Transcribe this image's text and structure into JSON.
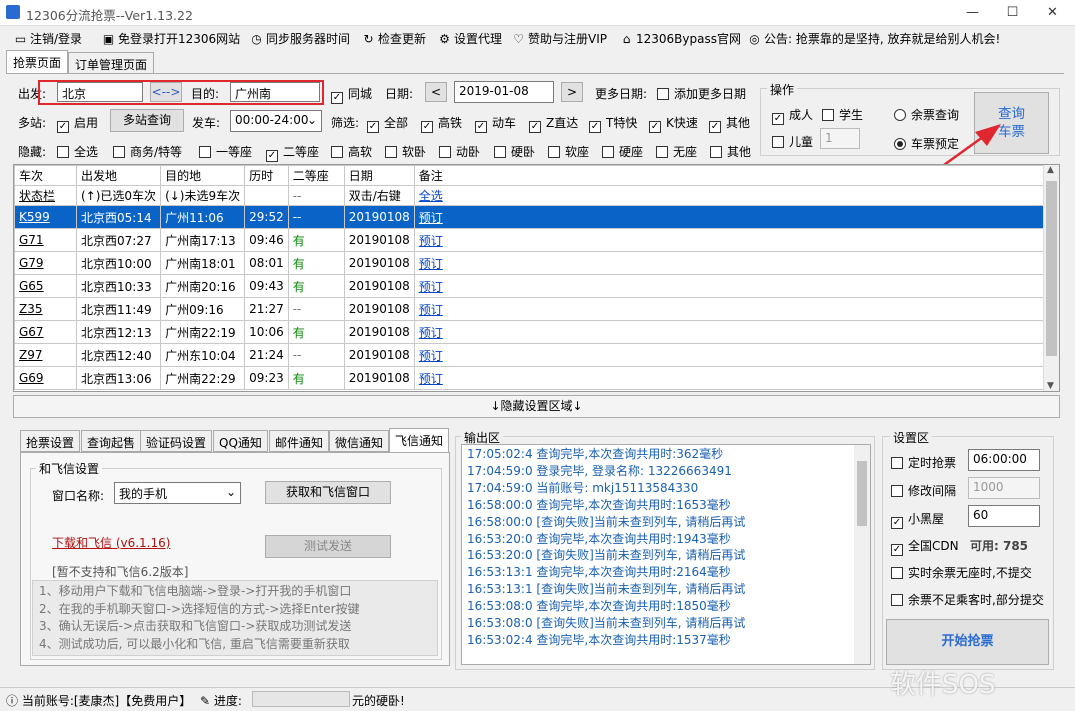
{
  "window": {
    "title": "12306分流抢票--Ver1.13.22",
    "min": "—",
    "max": "☐",
    "close": "✕"
  },
  "menu": [
    {
      "icon": "▭",
      "label": "注销/登录"
    },
    {
      "icon": "▣",
      "label": "免登录打开12306网站"
    },
    {
      "icon": "◷",
      "label": "同步服务器时间"
    },
    {
      "icon": "↻",
      "label": "检查更新"
    },
    {
      "icon": "⚙",
      "label": "设置代理"
    },
    {
      "icon": "♡",
      "label": "赞助与注册VIP"
    },
    {
      "icon": "⌂",
      "label": "12306Bypass官网"
    },
    {
      "icon": "◎",
      "label": "公告: 抢票靠的是坚持, 放弃就是给别人机会!"
    }
  ],
  "tabs": [
    "抢票页面",
    "订单管理页面"
  ],
  "query": {
    "from_label": "出发:",
    "from": "北京",
    "swap": "<-->",
    "to_label": "目的:",
    "to": "广州南",
    "tongcheng": "同城",
    "date_label": "日期:",
    "date": "2019-01-08",
    "prev": "<",
    "next": ">",
    "more_dates_label": "更多日期:",
    "add_more_dates": "添加更多日期",
    "multi_label": "多站:",
    "multi_enable": "启用",
    "multi_query": "多站查询",
    "depart_label": "发车:",
    "depart_time": "00:00-24:00",
    "filter_label": "筛选:",
    "filters": [
      "全部",
      "高铁",
      "动车",
      "Z直达",
      "T特快",
      "K快速",
      "其他"
    ],
    "hide_label": "隐藏:",
    "hides": [
      "全选",
      "商务/特等",
      "一等座",
      "二等座",
      "高软",
      "软卧",
      "动卧",
      "硬卧",
      "软座",
      "硬座",
      "无座",
      "其他"
    ]
  },
  "ops": {
    "title": "操作",
    "adult": "成人",
    "student": "学生",
    "child": "儿童",
    "child_count": "1",
    "remain": "余票查询",
    "book": "车票预定",
    "query_btn1": "查询",
    "query_btn2": "车票"
  },
  "table": {
    "headers": [
      "车次",
      "出发地",
      "目的地",
      "历时",
      "二等座",
      "日期",
      "备注"
    ],
    "sub": [
      "状态栏",
      "(↑)已选0车次",
      "(↓)未选9车次",
      "",
      "--",
      "双击/右键",
      "全选"
    ],
    "rows": [
      [
        "K599",
        "北京西05:14",
        "广州11:06",
        "29:52",
        "--",
        "20190108",
        "预订"
      ],
      [
        "G71",
        "北京西07:27",
        "广州南17:13",
        "09:46",
        "有",
        "20190108",
        "预订"
      ],
      [
        "G79",
        "北京西10:00",
        "广州南18:01",
        "08:01",
        "有",
        "20190108",
        "预订"
      ],
      [
        "G65",
        "北京西10:33",
        "广州南20:16",
        "09:43",
        "有",
        "20190108",
        "预订"
      ],
      [
        "Z35",
        "北京西11:49",
        "广州09:16",
        "21:27",
        "--",
        "20190108",
        "预订"
      ],
      [
        "G67",
        "北京西12:13",
        "广州南22:19",
        "10:06",
        "有",
        "20190108",
        "预订"
      ],
      [
        "Z97",
        "北京西12:40",
        "广州东10:04",
        "21:24",
        "--",
        "20190108",
        "预订"
      ],
      [
        "G69",
        "北京西13:06",
        "广州南22:29",
        "09:23",
        "有",
        "20190108",
        "预订"
      ]
    ]
  },
  "hide_area": "↓隐藏设置区域↓",
  "settings_tabs": [
    "抢票设置",
    "查询起售",
    "验证码设置",
    "QQ通知",
    "邮件通知",
    "微信通知",
    "飞信通知"
  ],
  "feixin": {
    "group": "和飞信设置",
    "window_label": "窗口名称:",
    "window_value": "我的手机",
    "get_btn": "获取和飞信窗口",
    "download": "下载和飞信 (v6.1.16)",
    "test_btn": "测试发送",
    "note": "[暂不支持和飞信6.2版本]",
    "steps": [
      "1、移动用户下载和飞信电脑端->登录->打开我的手机窗口",
      "2、在我的手机聊天窗口->选择短信的方式->选择Enter按键",
      "3、确认无误后->点击获取和飞信窗口->获取成功测试发送",
      "4、测试成功后, 可以最小化和飞信, 重启飞信需要重新获取"
    ]
  },
  "output": {
    "title": "输出区",
    "lines": [
      "17:05:02:4  查询完毕,本次查询共用时:362毫秒",
      "17:04:59:0  登录完毕, 登录名称: 13226663491",
      "17:04:59:0  当前账号: mkj15113584330",
      "16:58:00:0  查询完毕,本次查询共用时:1653毫秒",
      "16:58:00:0  [查询失败]当前未查到列车, 请稍后再试",
      "16:53:20:0  查询完毕,本次查询共用时:1943毫秒",
      "16:53:20:0  [查询失败]当前未查到列车, 请稍后再试",
      "16:53:13:1  查询完毕,本次查询共用时:2164毫秒",
      "16:53:13:1  [查询失败]当前未查到列车, 请稍后再试",
      "16:53:08:0  查询完毕,本次查询共用时:1850毫秒",
      "16:53:08:0  [查询失败]当前未查到列车, 请稍后再试",
      "16:53:02:4  查询完毕,本次查询共用时:1537毫秒"
    ]
  },
  "setting": {
    "title": "设置区",
    "timed": "定时抢票",
    "timed_val": "06:00:00",
    "interval": "修改间隔",
    "interval_val": "1000",
    "black": "小黑屋",
    "black_val": "60",
    "cdn": "全国CDN",
    "cdn_avail": "可用: 785",
    "rt": "实时余票无座时,不提交",
    "partial": "余票不足乘客时,部分提交",
    "start": "开始抢票"
  },
  "status": {
    "account": "当前账号:[麦康杰]【免费用户】",
    "progress": "进度:",
    "tail": "元的硬卧!",
    "watermark": "软件SOS"
  }
}
